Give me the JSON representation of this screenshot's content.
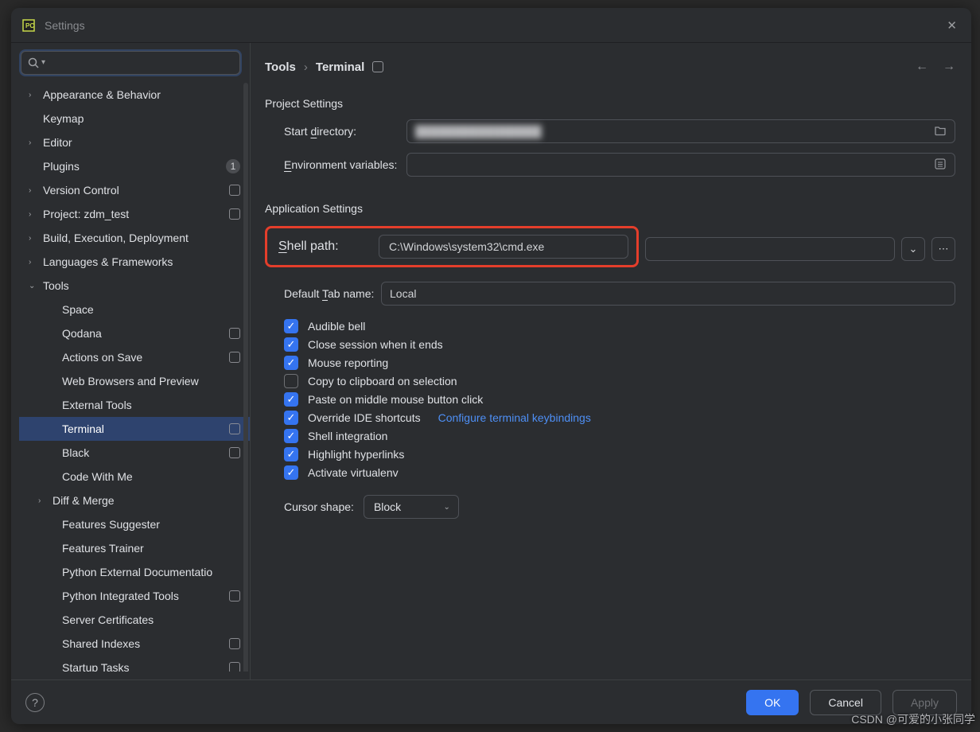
{
  "window": {
    "title": "Settings"
  },
  "sidebar": {
    "search_placeholder": "",
    "items": [
      {
        "label": "Appearance & Behavior",
        "depth": 1,
        "expandable": true,
        "badge": null
      },
      {
        "label": "Keymap",
        "depth": 1,
        "expandable": false
      },
      {
        "label": "Editor",
        "depth": 1,
        "expandable": true
      },
      {
        "label": "Plugins",
        "depth": 1,
        "expandable": false,
        "count": "1"
      },
      {
        "label": "Version Control",
        "depth": 1,
        "expandable": true,
        "badge": true
      },
      {
        "label": "Project: zdm_test",
        "depth": 1,
        "expandable": true,
        "badge": true
      },
      {
        "label": "Build, Execution, Deployment",
        "depth": 1,
        "expandable": true
      },
      {
        "label": "Languages & Frameworks",
        "depth": 1,
        "expandable": true
      },
      {
        "label": "Tools",
        "depth": 1,
        "expandable": true,
        "expanded": true
      },
      {
        "label": "Space",
        "depth": 2
      },
      {
        "label": "Qodana",
        "depth": 2,
        "badge": true
      },
      {
        "label": "Actions on Save",
        "depth": 2,
        "badge": true
      },
      {
        "label": "Web Browsers and Preview",
        "depth": 2
      },
      {
        "label": "External Tools",
        "depth": 2
      },
      {
        "label": "Terminal",
        "depth": 2,
        "badge": true,
        "selected": true
      },
      {
        "label": "Black",
        "depth": 2,
        "badge": true
      },
      {
        "label": "Code With Me",
        "depth": 2
      },
      {
        "label": "Diff & Merge",
        "depth": 2,
        "expandable": true
      },
      {
        "label": "Features Suggester",
        "depth": 2
      },
      {
        "label": "Features Trainer",
        "depth": 2
      },
      {
        "label": "Python External Documentatio",
        "depth": 2
      },
      {
        "label": "Python Integrated Tools",
        "depth": 2,
        "badge": true
      },
      {
        "label": "Server Certificates",
        "depth": 2
      },
      {
        "label": "Shared Indexes",
        "depth": 2,
        "badge": true
      },
      {
        "label": "Startup Tasks",
        "depth": 2,
        "badge": true
      }
    ]
  },
  "breadcrumbs": {
    "root": "Tools",
    "leaf": "Terminal"
  },
  "sections": {
    "project": "Project Settings",
    "application": "Application Settings"
  },
  "form": {
    "start_directory_label": "Start directory:",
    "start_directory_value": "",
    "env_vars_label": "Environment variables:",
    "env_vars_value": "",
    "shell_path_label": "Shell path:",
    "shell_path_value": "C:\\Windows\\system32\\cmd.exe",
    "default_tab_label": "Default Tab name:",
    "default_tab_value": "Local",
    "cursor_shape_label": "Cursor shape:",
    "cursor_shape_value": "Block",
    "keybind_link": "Configure terminal keybindings"
  },
  "checkboxes": [
    {
      "label": "Audible bell",
      "checked": true
    },
    {
      "label": "Close session when it ends",
      "checked": true
    },
    {
      "label": "Mouse reporting",
      "checked": true
    },
    {
      "label": "Copy to clipboard on selection",
      "checked": false
    },
    {
      "label": "Paste on middle mouse button click",
      "checked": true
    },
    {
      "label": "Override IDE shortcuts",
      "checked": true,
      "has_link": true
    },
    {
      "label": "Shell integration",
      "checked": true
    },
    {
      "label": "Highlight hyperlinks",
      "checked": true
    },
    {
      "label": "Activate virtualenv",
      "checked": true
    }
  ],
  "footer": {
    "ok": "OK",
    "cancel": "Cancel",
    "apply": "Apply"
  },
  "watermark": "CSDN @可爱的小张同学"
}
